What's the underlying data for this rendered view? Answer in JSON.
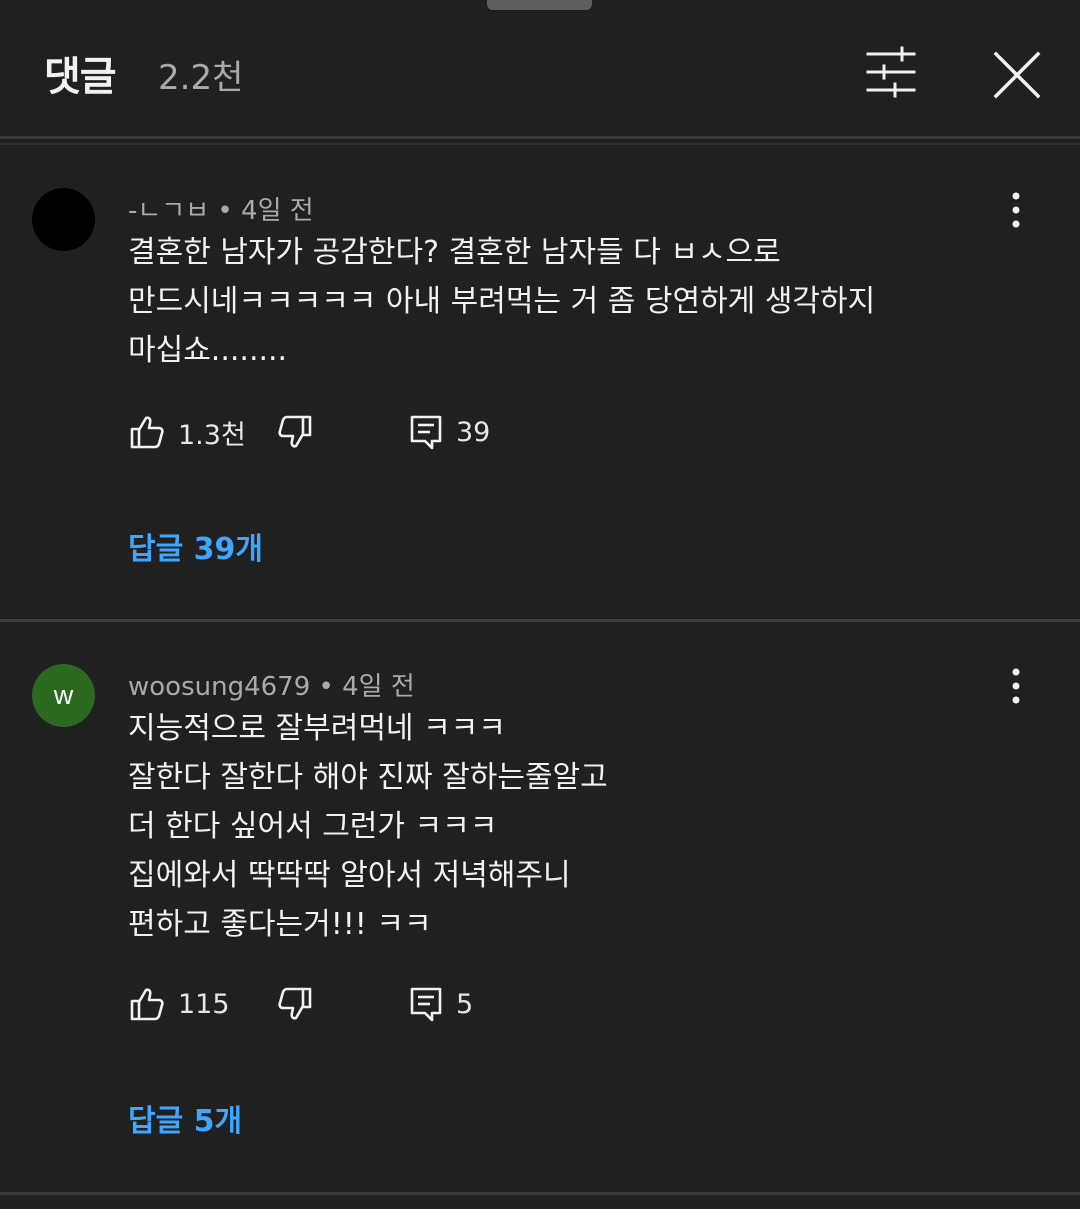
{
  "header": {
    "title": "댓글",
    "count": "2.2천"
  },
  "icons": {
    "filter": "sliders-icon",
    "close": "close-icon",
    "more": "more-vertical-icon",
    "like": "thumbs-up-icon",
    "dislike": "thumbs-down-icon",
    "reply": "comment-icon"
  },
  "colors": {
    "background": "#202020",
    "link": "#3ea6ff",
    "avatar_green": "#2b6a1e"
  },
  "comments": [
    {
      "author": "-ㄴㄱㅂ",
      "time": "4일 전",
      "avatar_letter": "",
      "avatar_color": "#000000",
      "lines": [
        "결혼한 남자가 공감한다? 결혼한 남자들 다 ㅂㅅ으로",
        "만드시네ㅋㅋㅋㅋㅋ 아내 부려먹는 거 좀 당연하게 생각하지",
        "마십쇼........"
      ],
      "likes": "1.3천",
      "reply_count": "39",
      "replies_label": "답글 39개"
    },
    {
      "author": "woosung4679",
      "time": "4일 전",
      "avatar_letter": "w",
      "avatar_color": "#2b6a1e",
      "lines": [
        "지능적으로 잘부려먹네 ㅋㅋㅋ",
        "잘한다 잘한다 해야 진짜 잘하는줄알고",
        "더 한다 싶어서 그런가 ㅋㅋㅋ",
        "집에와서 딱딱딱 알아서 저녁해주니",
        "편하고 좋다는거!!! ㅋㅋ"
      ],
      "likes": "115",
      "reply_count": "5",
      "replies_label": "답글 5개"
    }
  ]
}
